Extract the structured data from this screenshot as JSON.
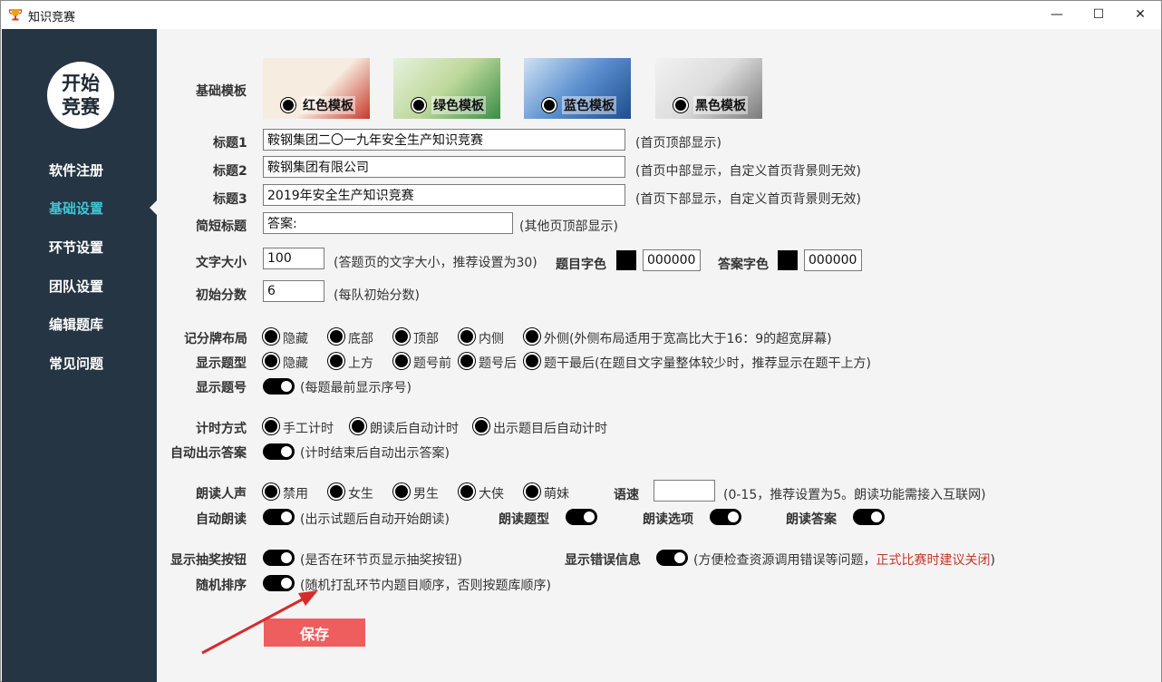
{
  "window": {
    "title": "知识竞赛",
    "minimize": "—",
    "maximize": "☐",
    "close": "✕"
  },
  "sidebar": {
    "logo_line1": "开始",
    "logo_line2": "竞赛",
    "items": [
      {
        "label": "软件注册"
      },
      {
        "label": "基础设置"
      },
      {
        "label": "环节设置"
      },
      {
        "label": "团队设置"
      },
      {
        "label": "编辑题库"
      },
      {
        "label": "常见问题"
      }
    ],
    "active_index": 1
  },
  "settings": {
    "template": {
      "label": "基础模板",
      "options": [
        {
          "label": "红色模板",
          "colors": [
            "#c0392b",
            "#f3e6d8"
          ]
        },
        {
          "label": "绿色模板",
          "colors": [
            "#3c9a4a",
            "#e9f1df"
          ]
        },
        {
          "label": "蓝色模板",
          "colors": [
            "#2c5fa8",
            "#d9e7f4"
          ]
        },
        {
          "label": "黑色模板",
          "colors": [
            "#333333",
            "#eeeeee"
          ]
        }
      ]
    },
    "title1": {
      "label": "标题1",
      "value": "鞍钢集团二〇一九年安全生产知识竞赛",
      "hint": "(首页顶部显示)"
    },
    "title2": {
      "label": "标题2",
      "value": "鞍钢集团有限公司",
      "hint": "(首页中部显示，自定义首页背景则无效)"
    },
    "title3": {
      "label": "标题3",
      "value": "2019年安全生产知识竞赛",
      "hint": "(首页下部显示，自定义首页背景则无效)"
    },
    "short_title": {
      "label": "简短标题",
      "value": "答案:",
      "hint": "(其他页顶部显示)"
    },
    "font_size": {
      "label": "文字大小",
      "value": "100",
      "hint": "(答题页的文字大小，推荐设置为30)"
    },
    "question_color": {
      "label": "题目字色",
      "value": "000000",
      "color": "#000000"
    },
    "answer_color": {
      "label": "答案字色",
      "value": "000000",
      "color": "#000000"
    },
    "initial_score": {
      "label": "初始分数",
      "value": "6",
      "hint": "(每队初始分数)"
    },
    "scoreboard": {
      "label": "记分牌布局",
      "options": [
        "隐藏",
        "底部",
        "顶部",
        "内侧"
      ],
      "last_option": "外侧(外侧布局适用于宽高比大于16：9的超宽屏幕)"
    },
    "question_type": {
      "label": "显示题型",
      "options": [
        "隐藏",
        "上方",
        "题号前",
        "题号后"
      ],
      "last_option": "题干最后(在题目文字量整体较少时，推荐显示在题干上方)"
    },
    "question_number": {
      "label": "显示题号",
      "hint": "(每题最前显示序号)"
    },
    "timer": {
      "label": "计时方式",
      "options": [
        "手工计时",
        "朗读后自动计时",
        "出示题目后自动计时"
      ]
    },
    "auto_answer": {
      "label": "自动出示答案",
      "hint": "(计时结束后自动出示答案)"
    },
    "voice": {
      "label": "朗读人声",
      "options": [
        "禁用",
        "女生",
        "男生",
        "大侠",
        "萌妹"
      ]
    },
    "speed": {
      "label": "语速",
      "value": "",
      "hint": "(0-15，推荐设置为5。朗读功能需接入互联网)"
    },
    "auto_read": {
      "label": "自动朗读",
      "hint": "(出示试题后自动开始朗读)"
    },
    "read_type": {
      "label": "朗读题型"
    },
    "read_options": {
      "label": "朗读选项"
    },
    "read_answer": {
      "label": "朗读答案"
    },
    "lottery": {
      "label": "显示抽奖按钮",
      "hint": "(是否在环节页显示抽奖按钮)"
    },
    "errors": {
      "label": "显示错误信息",
      "hint": "(方便检查资源调用错误等问题，",
      "warning": "正式比赛时建议关闭",
      "hint_end": ")"
    },
    "random": {
      "label": "随机排序",
      "hint": "(随机打乱环节内题目顺序，否则按题库顺序)"
    },
    "save_label": "保存"
  }
}
